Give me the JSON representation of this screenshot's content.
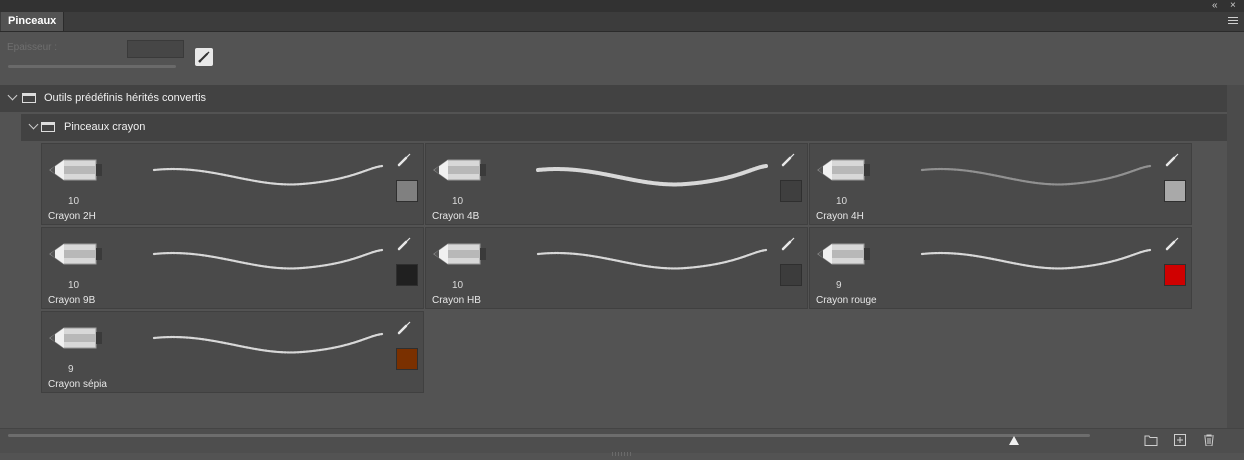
{
  "window": {
    "collapse_glyph": "«",
    "close_glyph": "×"
  },
  "panel": {
    "tab_label": "Pinceaux"
  },
  "size_control": {
    "label": "Epaisseur :",
    "value": ""
  },
  "groups": [
    {
      "label": "Outils prédéfinis hérités convertis",
      "icon": "folder-icon"
    },
    {
      "label": "Pinceaux crayon",
      "icon": "folder-icon"
    }
  ],
  "brushes": [
    {
      "name": "Crayon 2H",
      "size": "10",
      "color": "#808080"
    },
    {
      "name": "Crayon 4B",
      "size": "10",
      "color": "#3f3f3f"
    },
    {
      "name": "Crayon 4H",
      "size": "10",
      "color": "#a9a9a9"
    },
    {
      "name": "Crayon 9B",
      "size": "10",
      "color": "#202020"
    },
    {
      "name": "Crayon HB",
      "size": "10",
      "color": "#3c3c3c"
    },
    {
      "name": "Crayon rouge",
      "size": "9",
      "color": "#d00000"
    },
    {
      "name": "Crayon sépia",
      "size": "9",
      "color": "#7a3000"
    }
  ],
  "bottom": {
    "zoom_level": 0.93
  }
}
